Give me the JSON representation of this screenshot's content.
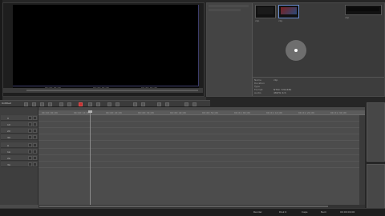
{
  "app": {
    "timeline_title": "Untitled"
  },
  "player": {
    "timecode_left": "00:00:00;00",
    "timecode_mid": "00:00:00;00",
    "timecode_right": "00:00:00;00"
  },
  "bin": {
    "clips": [
      {
        "label": "clip",
        "icon": "video-thumbnail-icon"
      },
      {
        "label": "clip",
        "icon": "video-thumbnail-icon"
      },
      {
        "label": "clip",
        "icon": "video-thumbnail-icon"
      }
    ],
    "properties": [
      {
        "key": "Name",
        "value": "clip"
      },
      {
        "key": "Duration",
        "value": ""
      },
      {
        "key": "Type",
        "value": ""
      },
      {
        "key": "Format",
        "value": "NTSC 720x480"
      },
      {
        "key": "Audio",
        "value": "48kHz 2ch"
      },
      {
        "key": "Path",
        "value": "C:\\Video"
      }
    ]
  },
  "timeline": {
    "tracks": [
      {
        "name": "V"
      },
      {
        "name": "1V"
      },
      {
        "name": "2V"
      },
      {
        "name": "3V"
      },
      {
        "name": "A"
      },
      {
        "name": "1A"
      },
      {
        "name": "2A"
      },
      {
        "name": "3A"
      }
    ],
    "ruler_ticks": [
      "00:00:00;00",
      "00:00:10;00",
      "00:00:20;00",
      "00:00:30;00",
      "00:00:40;00",
      "00:00:50;00",
      "00:01:00;00",
      "00:01:10;00",
      "00:01:20;00",
      "00:01:30;00"
    ]
  },
  "status": {
    "item1": "Render",
    "item2": "Disk 0",
    "item3": "Caps",
    "item4": "Num",
    "item5": "00:00:00;00"
  },
  "colors": {
    "record_button": "#c63030",
    "selection": "#6a8dd1"
  }
}
